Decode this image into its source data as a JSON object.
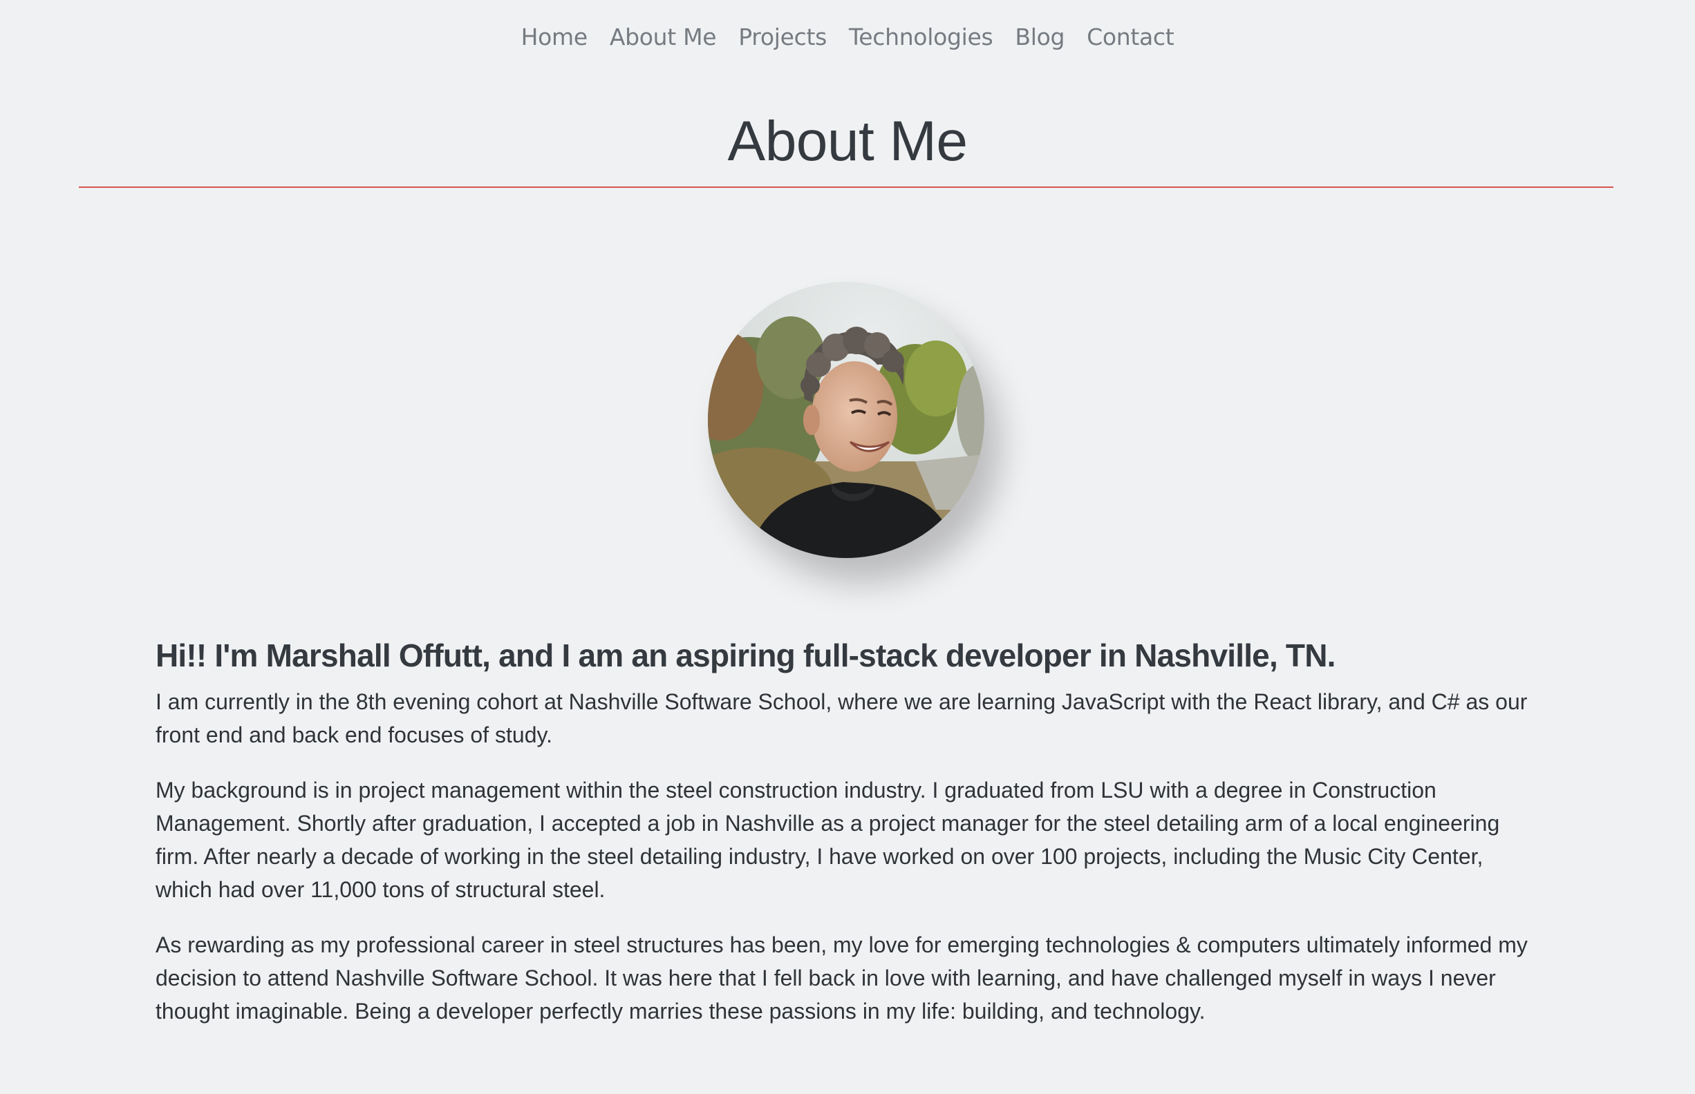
{
  "nav": {
    "items": [
      {
        "label": "Home"
      },
      {
        "label": "About Me"
      },
      {
        "label": "Projects"
      },
      {
        "label": "Technologies"
      },
      {
        "label": "Blog"
      },
      {
        "label": "Contact"
      }
    ]
  },
  "header": {
    "title": "About Me"
  },
  "colors": {
    "background": "#f0f1f3",
    "title_rule": "#d9534f",
    "nav_link": "#757b81",
    "text": "#343a40"
  },
  "profile": {
    "photo_icon": "profile-photo"
  },
  "about": {
    "greeting": "Hi!! I'm Marshall Offutt, and I am an aspiring full-stack developer in Nashville, TN.",
    "paragraphs": [
      "I am currently in the 8th evening cohort at Nashville Software School, where we are learning JavaScript with the React library, and C# as our front end and back end focuses of study.",
      "My background is in project management within the steel construction industry. I graduated from LSU with a degree in Construction Management. Shortly after graduation, I accepted a job in Nashville as a project manager for the steel detailing arm of a local engineering firm. After nearly a decade of working in the steel detailing industry, I have worked on over 100 projects, including the Music City Center, which had over 11,000 tons of structural steel.",
      "As rewarding as my professional career in steel structures has been, my love for emerging technologies & computers ultimately informed my decision to attend Nashville Software School. It was here that I fell back in love with learning, and have challenged myself in ways I never thought imaginable. Being a developer perfectly marries these passions in my life: building, and technology."
    ]
  }
}
